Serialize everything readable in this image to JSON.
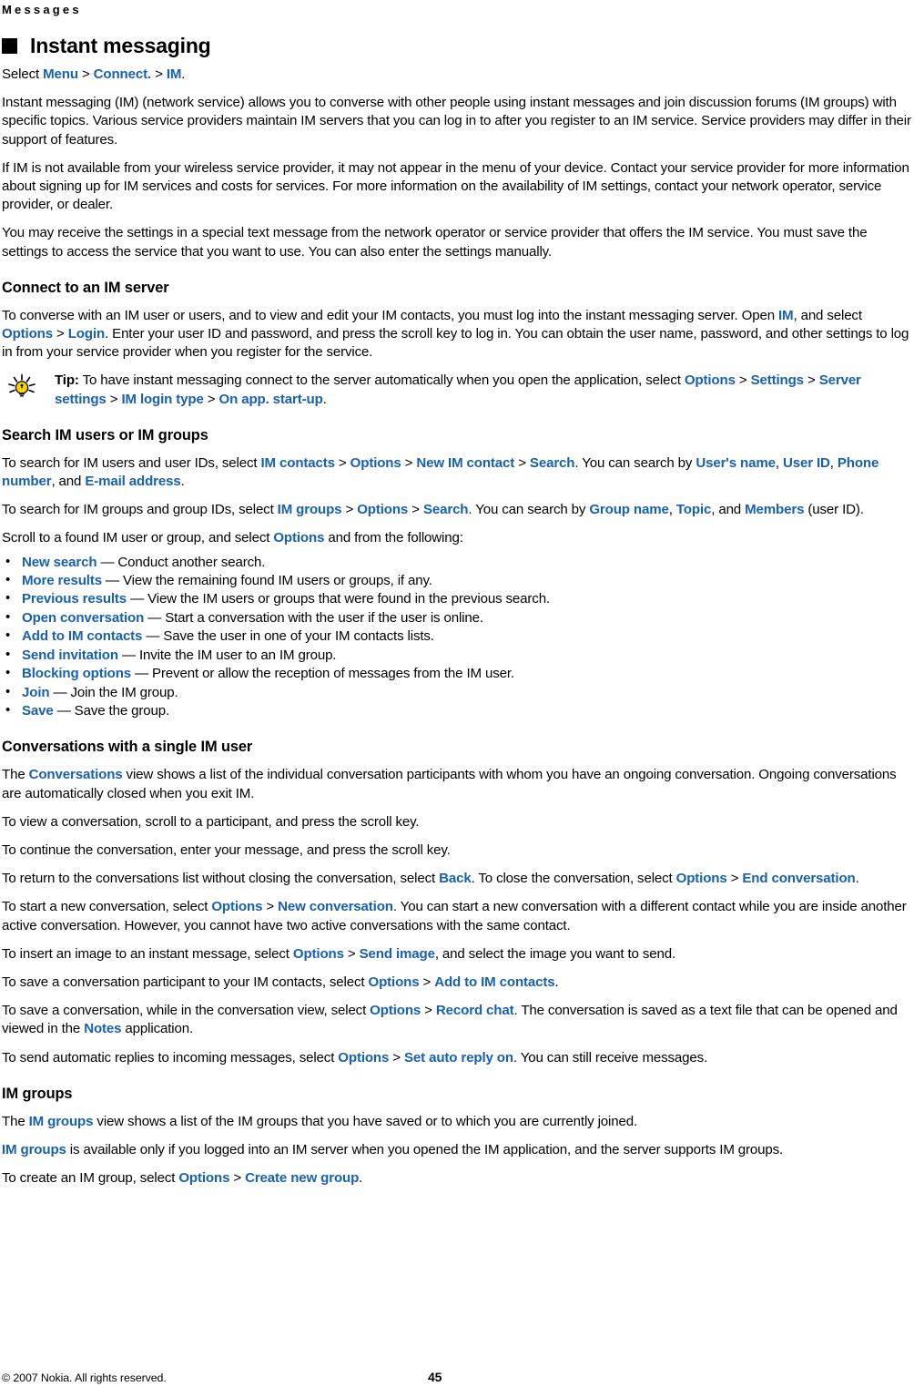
{
  "running_head": "Messages",
  "chapter": {
    "title": "Instant messaging"
  },
  "colors": {
    "link": "#1860b0",
    "text": "#000000",
    "background": "#ffffff",
    "tip_bulb": "#ffd500"
  },
  "intro": {
    "select_line": {
      "lead": "Select ",
      "path": [
        "Menu",
        "Connect.",
        "IM"
      ],
      "separator": " > ",
      "trailing": "."
    },
    "p1": "Instant messaging (IM) (network service) allows you to converse with other people using instant messages and join discussion forums (IM groups) with specific topics. Various service providers maintain IM servers that you can log in to after you register to an IM service. Service providers may differ in their support of features.",
    "p2": "If IM is not available from your wireless service provider, it may not appear in the menu of your device. Contact your service provider for more information about signing up for IM services and costs for services. For more information on the availability of IM settings, contact your network operator, service provider, or dealer.",
    "p3": "You may receive the settings in a special text message from the network operator or service provider that offers the IM service. You must save the settings to access the service that you want to use. You can also enter the settings manually."
  },
  "connect_section": {
    "heading": "Connect to an IM server",
    "p1_a": "To converse with an IM user or users, and to view and edit your IM contacts, you must log into the instant messaging server. Open ",
    "p1_link1": "IM",
    "p1_b": ", and select ",
    "p1_link2": "Options",
    "p1_sep": " > ",
    "p1_link3": "Login",
    "p1_c": ". Enter your user ID and password, and press the scroll key to log in. You can obtain the user name, password, and other settings to log in from your service provider when you register for the service.",
    "tip": {
      "icon": "lightbulb-icon",
      "label": "Tip:",
      "text_a": " To have instant messaging connect to the server automatically when you open the application, select ",
      "links": [
        "Options",
        "Settings",
        "Server settings",
        "IM login type",
        "On app. start-up"
      ],
      "separator": " > ",
      "trailing": "."
    }
  },
  "search_section": {
    "heading": "Search IM users or IM groups",
    "p1_a": "To search for IM users and user IDs, select ",
    "p1_links": [
      "IM contacts",
      "Options",
      "New IM contact",
      "Search"
    ],
    "p1_b": ". You can search by ",
    "p1_search_by": [
      "User's name",
      "User ID",
      "Phone number",
      "E-mail address"
    ],
    "p1_c": ".",
    "p2_a": "To search for IM groups and group IDs, select ",
    "p2_links": [
      "IM groups",
      "Options",
      "Search"
    ],
    "p2_b": ". You can search by ",
    "p2_search_by": [
      "Group name",
      "Topic",
      "Members"
    ],
    "p2_c": " (user ID).",
    "p3_a": "Scroll to a found IM user or group, and select ",
    "p3_link": "Options",
    "p3_b": " and from the following:",
    "options": [
      {
        "label": "New search",
        "desc": " — Conduct another search."
      },
      {
        "label": "More results",
        "desc": " — View the remaining found IM users or groups, if any."
      },
      {
        "label": "Previous results",
        "desc": " — View the IM users or groups that were found in the previous search."
      },
      {
        "label": "Open conversation",
        "desc": " — Start a conversation with the user if the user is online."
      },
      {
        "label": "Add to IM contacts",
        "desc": " — Save the user in one of your IM contacts lists."
      },
      {
        "label": "Send invitation",
        "desc": " — Invite the IM user to an IM group."
      },
      {
        "label": "Blocking options",
        "desc": " — Prevent or allow the reception of messages from the IM user."
      },
      {
        "label": "Join",
        "desc": " — Join the IM group."
      },
      {
        "label": "Save",
        "desc": " — Save the group."
      }
    ]
  },
  "conversations_section": {
    "heading": "Conversations with a single IM user",
    "p1_a": "The ",
    "p1_link": "Conversations",
    "p1_b": " view shows a list of the individual conversation participants with whom you have an ongoing conversation. Ongoing conversations are automatically closed when you exit IM.",
    "p2": "To view a conversation, scroll to a participant, and press the scroll key.",
    "p3": "To continue the conversation, enter your message, and press the scroll key.",
    "p4_a": "To return to the conversations list without closing the conversation, select ",
    "p4_link1": "Back",
    "p4_b": ". To close the conversation, select ",
    "p4_link2": "Options",
    "p4_sep": " > ",
    "p4_link3": "End conversation",
    "p4_c": ".",
    "p5_a": "To start a new conversation, select ",
    "p5_link1": "Options",
    "p5_sep": " > ",
    "p5_link2": "New conversation",
    "p5_b": ". You can start a new conversation with a different contact while you are inside another active conversation. However, you cannot have two active conversations with the same contact.",
    "p6_a": "To insert an image to an instant message, select ",
    "p6_link1": "Options",
    "p6_sep": " > ",
    "p6_link2": "Send image",
    "p6_b": ", and select the image you want to send.",
    "p7_a": "To save a conversation participant to your IM contacts, select ",
    "p7_link1": "Options",
    "p7_sep": " > ",
    "p7_link2": "Add to IM contacts",
    "p7_b": ".",
    "p8_a": "To save a conversation, while in the conversation view, select ",
    "p8_link1": "Options",
    "p8_sep": " > ",
    "p8_link2": "Record chat",
    "p8_b": ". The conversation is saved as a text file that can be opened and viewed in the ",
    "p8_link3": "Notes",
    "p8_c": " application.",
    "p9_a": "To send automatic replies to incoming messages, select ",
    "p9_link1": "Options",
    "p9_sep": " > ",
    "p9_link2": "Set auto reply on",
    "p9_b": ". You can still receive messages."
  },
  "imgroups_section": {
    "heading": "IM groups",
    "p1_a": "The ",
    "p1_link": "IM groups",
    "p1_b": " view shows a list of the IM groups that you have saved or to which you are currently joined.",
    "p2_link": "IM groups",
    "p2_a": " is available only if you logged into an IM server when you opened the IM application, and the server supports IM groups.",
    "p3_a": "To create an IM group, select ",
    "p3_link1": "Options",
    "p3_sep": " > ",
    "p3_link2": "Create new group",
    "p3_b": "."
  },
  "footer": {
    "copyright": "© 2007 Nokia. All rights reserved.",
    "page_number": "45"
  }
}
